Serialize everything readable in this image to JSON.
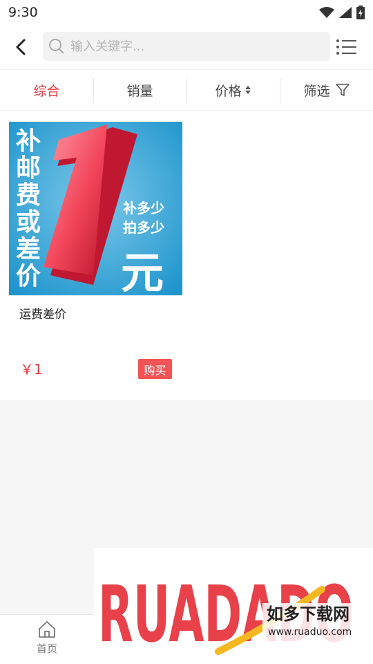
{
  "status_bar": {
    "time": "9:30"
  },
  "search": {
    "placeholder": "输入关键字..."
  },
  "filters": [
    {
      "label": "综合",
      "active": true
    },
    {
      "label": "销量"
    },
    {
      "label": "价格"
    },
    {
      "label": "筛选"
    }
  ],
  "product": {
    "image_text": {
      "left_vertical": [
        "补",
        "邮",
        "费",
        "或",
        "差",
        "价"
      ],
      "big_number": "1",
      "line1": "补多少",
      "line2": "拍多少",
      "unit": "元"
    },
    "title": "运费差价",
    "price": "￥1",
    "buy_label": "购买"
  },
  "tab_bar": {
    "home_label": "首页"
  },
  "watermark": {
    "brand": "RUADADO",
    "chinese": "如多下载网",
    "url": "www.ruaduo.com"
  },
  "colors": {
    "accent": "#e4393c",
    "buy_button": "#f25354"
  }
}
